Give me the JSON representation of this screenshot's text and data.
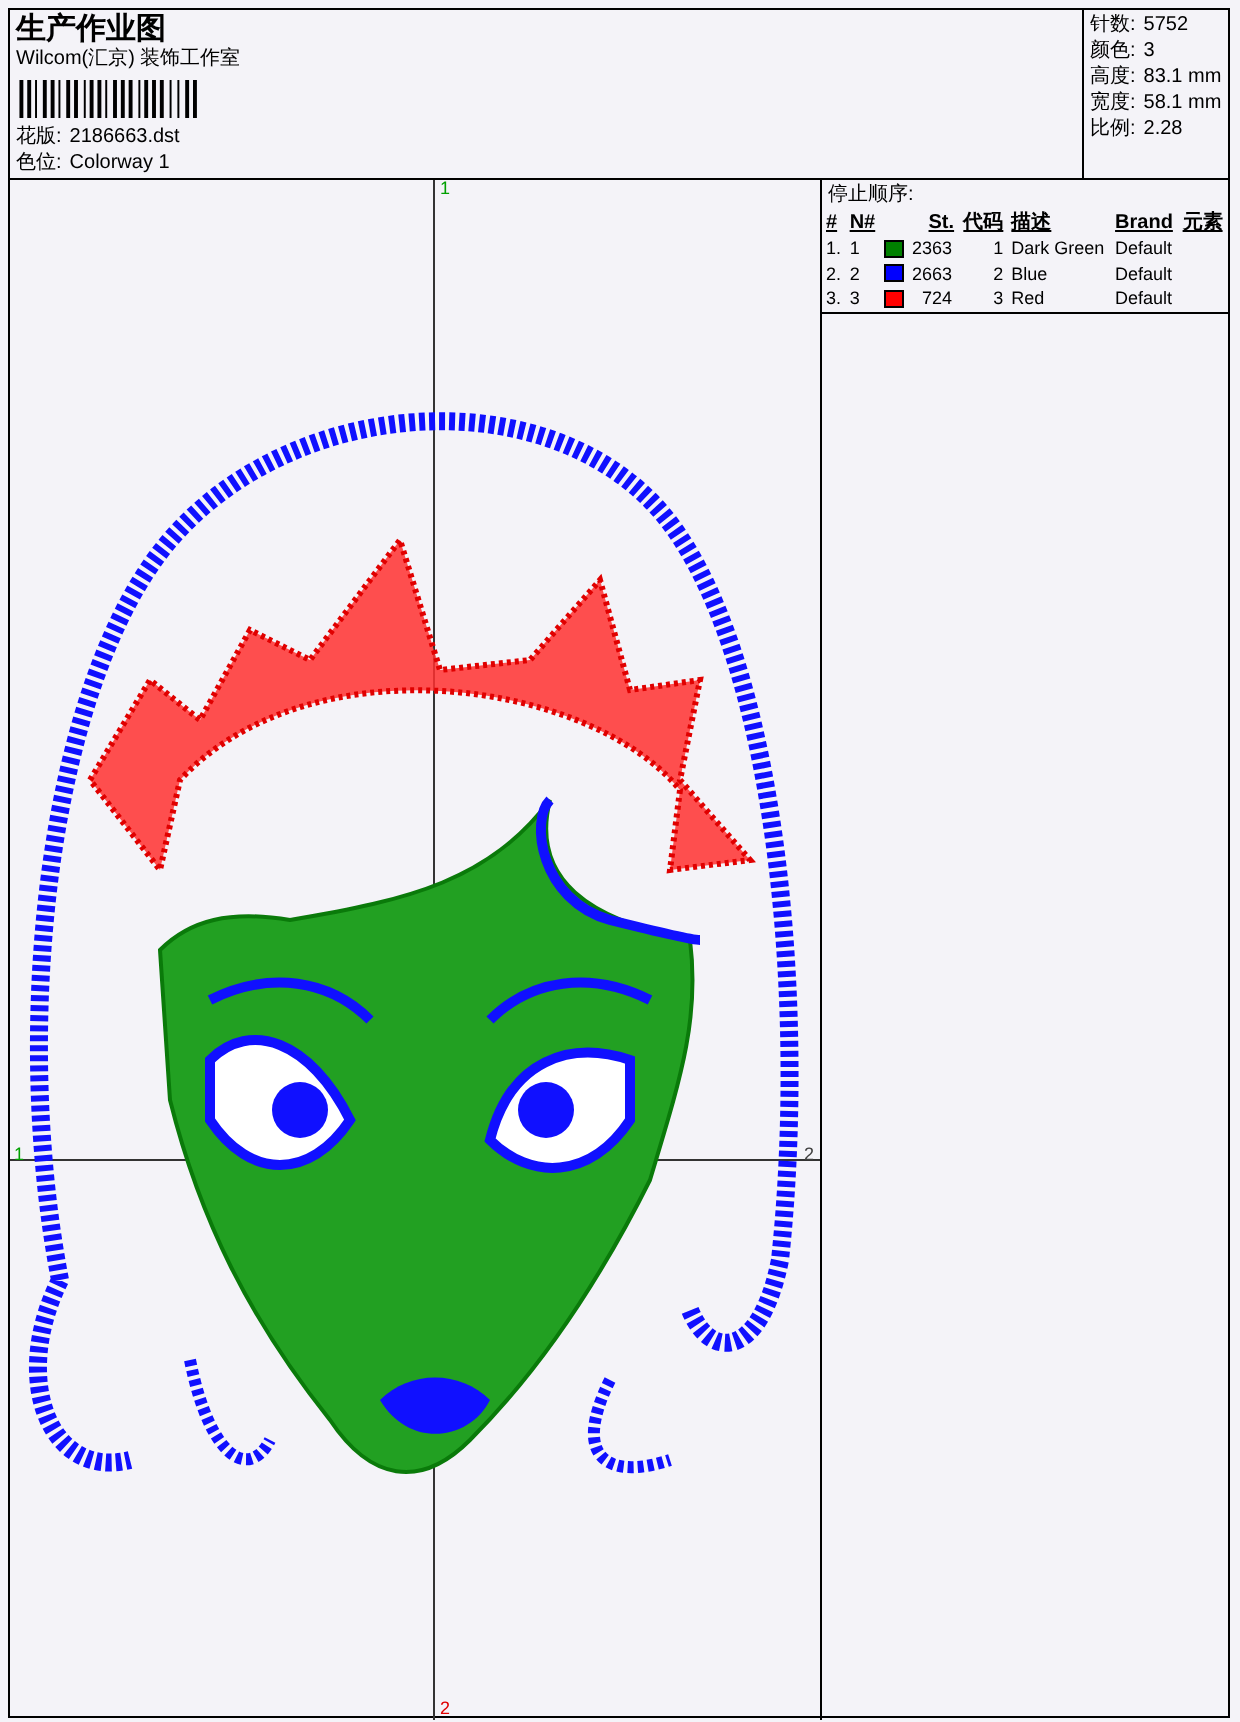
{
  "header": {
    "title": "生产作业图",
    "company": "Wilcom(汇京) 装饰工作室",
    "design_label": "花版:",
    "design": "2186663.dst",
    "colorway_label": "色位:",
    "colorway": "Colorway 1"
  },
  "stats": [
    {
      "label": "针数:",
      "value": "5752"
    },
    {
      "label": "颜色:",
      "value": "3"
    },
    {
      "label": "高度:",
      "value": "83.1 mm"
    },
    {
      "label": "宽度:",
      "value": "58.1 mm"
    },
    {
      "label": "比例:",
      "value": "2.28"
    }
  ],
  "canvas": {
    "axis_labels": [
      {
        "kind": "top",
        "text": "1",
        "color": "#00a000"
      },
      {
        "kind": "bottom",
        "text": "2",
        "color": "#e00000"
      },
      {
        "kind": "left",
        "text": "1",
        "color": "#00a000"
      },
      {
        "kind": "right",
        "text": "2",
        "color": "#404040"
      }
    ]
  },
  "stop_sequence": {
    "title": "停止顺序:",
    "columns": [
      "#",
      "N#",
      "St.",
      "代码",
      "描述",
      "Brand",
      "元素"
    ],
    "rows": [
      {
        "index": "1.",
        "needle": "1",
        "color": "#008000",
        "stitches": "2363",
        "code": "1",
        "description": "Dark Green",
        "brand": "Default"
      },
      {
        "index": "2.",
        "needle": "2",
        "color": "#0000ff",
        "stitches": "2663",
        "code": "2",
        "description": "Blue",
        "brand": "Default"
      },
      {
        "index": "3.",
        "needle": "3",
        "color": "#ff0000",
        "stitches": "724",
        "code": "3",
        "description": "Red",
        "brand": "Default"
      }
    ]
  }
}
